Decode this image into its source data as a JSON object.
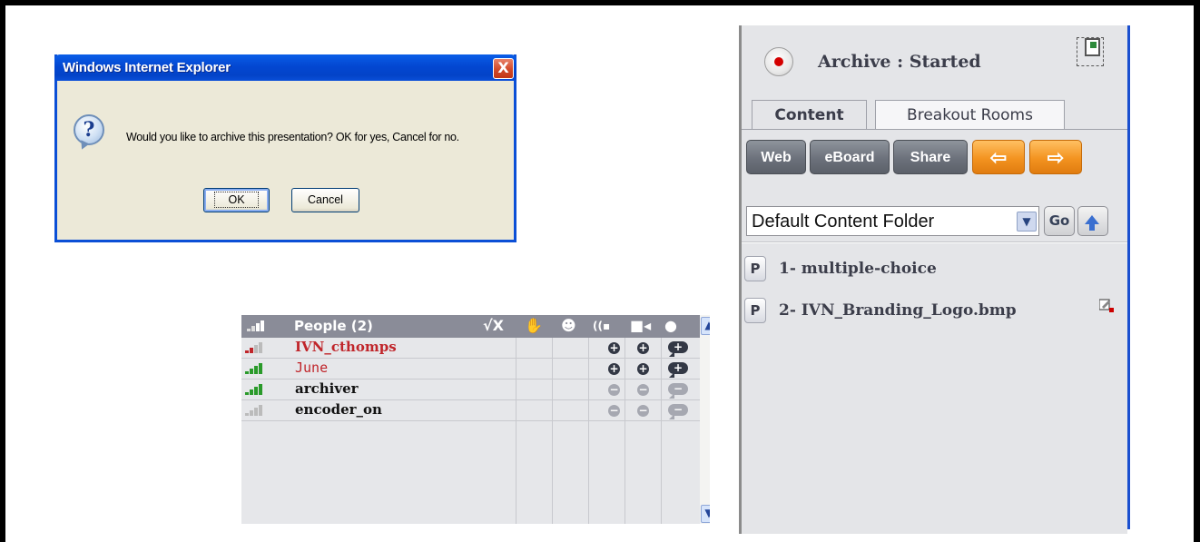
{
  "dialog": {
    "title": "Windows Internet Explorer",
    "close_glyph": "X",
    "icon": "question-icon",
    "message": "Would you like to archive this presentation? OK for yes, Cancel for no.",
    "ok_label": "OK",
    "cancel_label": "Cancel"
  },
  "people": {
    "title": "People (2)",
    "header_icons": [
      "check-x-icon",
      "raise-hand-icon",
      "smiley-icon",
      "audio-icon",
      "video-icon",
      "chat-icon"
    ],
    "header_check": "√X",
    "users": [
      {
        "name": "IVN_cthomps",
        "color": "#c0252a",
        "signal": "red",
        "controls": "on"
      },
      {
        "name": "June",
        "color": "#c0252a",
        "signal": "green",
        "controls": "on"
      },
      {
        "name": "archiver",
        "color": "#111111",
        "signal": "green",
        "controls": "off"
      },
      {
        "name": "encoder_on",
        "color": "#111111",
        "signal": "gray",
        "controls": "off"
      }
    ]
  },
  "archive": {
    "status": "Archive : Started",
    "tabs": [
      {
        "label": "Content",
        "active": true
      },
      {
        "label": "Breakout Rooms",
        "active": false
      }
    ],
    "toolbar": {
      "web": "Web",
      "eboard": "eBoard",
      "share": "Share",
      "back_icon": "arrow-left-icon",
      "forward_icon": "arrow-right-icon"
    },
    "folder_select": "Default Content Folder",
    "go_label": "Go",
    "content_items": [
      {
        "badge": "P",
        "name": "1- multiple-choice"
      },
      {
        "badge": "P",
        "name": "2- IVN_Branding_Logo.bmp"
      }
    ]
  },
  "colors": {
    "xp_blue": "#0347d1",
    "panel_gray": "#8a8c98",
    "record_red": "#d40000",
    "orange": "#f39320"
  }
}
